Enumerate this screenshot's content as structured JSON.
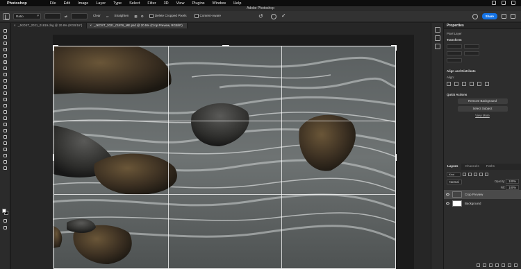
{
  "menubar": {
    "items": [
      "Photoshop",
      "File",
      "Edit",
      "Image",
      "Layer",
      "Type",
      "Select",
      "Filter",
      "3D",
      "View",
      "Plugins",
      "Window",
      "Help"
    ]
  },
  "titlebar": {
    "title": "Adobe Photoshop"
  },
  "options": {
    "ratio_label": "Ratio",
    "clear_label": "Clear",
    "straighten_label": "Straighten",
    "delete_cropped_label": "Delete Cropped Pixels",
    "content_aware_label": "Content-Aware",
    "share_label": "Share"
  },
  "tabs": [
    {
      "label": "_JKOST_2021_01819.dng @ 20.8% (RGB/16*)"
    },
    {
      "label": "_JKOST_2021_01876_ME.psd @ 20.5% (Crop Preview, RGB/8*)"
    }
  ],
  "properties": {
    "title": "Properties",
    "layer_type": "Pixel Layer",
    "transform_label": "Transform",
    "align_title": "Align and Distribute",
    "align_label": "Align:",
    "quick_actions_title": "Quick Actions",
    "remove_bg_label": "Remove Background",
    "select_subject_label": "Select Subject",
    "view_more_label": "View More"
  },
  "layers": {
    "tabs": [
      "Layers",
      "Channels",
      "Paths"
    ],
    "kind_label": "Kind",
    "blend_mode": "Normal",
    "opacity_label": "Opacity:",
    "opacity_value": "100%",
    "fill_label": "Fill:",
    "fill_value": "100%",
    "items": [
      {
        "name": "Crop Preview",
        "selected": true
      },
      {
        "name": "Background",
        "selected": false
      }
    ]
  },
  "colors": {
    "accent": "#1473e6",
    "panel": "#2d2d2d",
    "canvas": "#262626"
  }
}
